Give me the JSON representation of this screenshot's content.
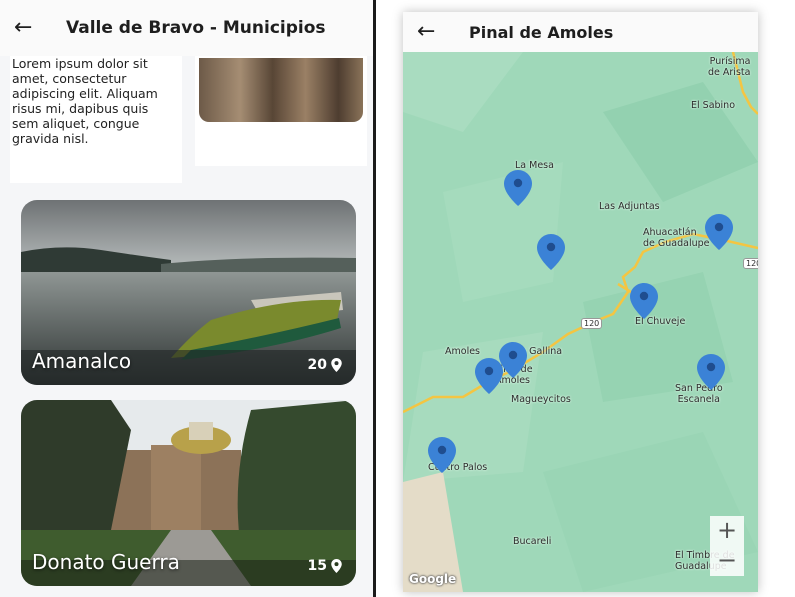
{
  "left_screen": {
    "header": {
      "back_icon": "arrow-left",
      "title": "Valle de Bravo - Municipios"
    },
    "intro_text": "Lorem ipsum dolor sit amet, consectetur adipiscing elit. Aliquam risus mi, dapibus quis sem aliquet, congue gravida nisl.",
    "places": [
      {
        "name": "Amanalco",
        "count": "20"
      },
      {
        "name": "Donato Guerra",
        "count": "15"
      }
    ]
  },
  "right_screen": {
    "header": {
      "back_icon": "arrow-left",
      "title": "Pinal de Amoles"
    },
    "map": {
      "labels": {
        "purisima": "Purísima\nde Arista",
        "el_sabino": "El Sabino",
        "la_mesa": "La Mesa",
        "las_adjuntas": "Las Adjuntas",
        "ahuacatlan": "Ahuacatlán\nde Guadalupe",
        "el_chuveje": "El Chuveje",
        "amoles": "Amoles",
        "la_gallina": "La Gallina",
        "pinal_de_amoles": "Pinal de\nAmoles",
        "magueycitos": "Magueycitos",
        "san_pedro": "San Pedro\nEscanela",
        "cuatro_palos": "Cuatro Palos",
        "bucareli": "Bucareli",
        "el_timbre": "El Timbre de\nGuadalupe",
        "route_120a": "120",
        "route_120b": "120"
      },
      "zoom_in": "+",
      "zoom_out": "−",
      "attribution": "Google",
      "marker_color": "#3b82d6"
    }
  }
}
